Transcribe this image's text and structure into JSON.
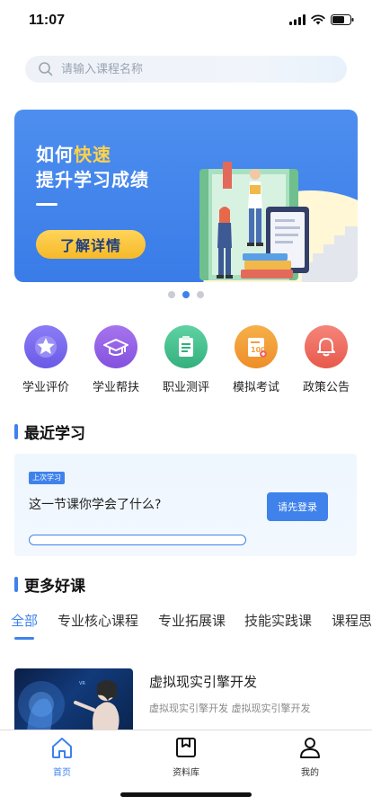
{
  "status_bar": {
    "time": "11:07"
  },
  "search": {
    "placeholder": "请输入课程名称"
  },
  "banner": {
    "title_prefix": "如何",
    "title_highlight": "快速",
    "title_line2": "提升学习成绩",
    "button_label": "了解详情",
    "page_count": 3,
    "active_index": 1
  },
  "quick_entries": [
    {
      "label": "学业评价",
      "icon": "star-icon",
      "color": "#7b6cf0"
    },
    {
      "label": "学业帮扶",
      "icon": "graduation-cap-icon",
      "color": "#9a63e8"
    },
    {
      "label": "职业测评",
      "icon": "clipboard-icon",
      "color": "#3fbf8e"
    },
    {
      "label": "模拟考试",
      "icon": "exam-paper-icon",
      "color": "#f2a03a"
    },
    {
      "label": "政策公告",
      "icon": "bell-icon",
      "color": "#ee6a5a"
    }
  ],
  "recent": {
    "section_title": "最近学习",
    "badge": "上次学习",
    "question": "这一节课你学会了什么?",
    "login_label": "请先登录",
    "progress": 0
  },
  "more_courses": {
    "section_title": "更多好课",
    "tabs": [
      "全部",
      "专业核心课程",
      "专业拓展课",
      "技能实践课",
      "课程思"
    ],
    "active_tab": 0
  },
  "course": {
    "title": "虚拟现实引擎开发",
    "subtitle": "虚拟现实引擎开发 虚拟现实引擎开发"
  },
  "bottom_nav": {
    "items": [
      {
        "label": "首页",
        "icon": "home-icon",
        "active": true
      },
      {
        "label": "资料库",
        "icon": "library-icon",
        "active": false
      },
      {
        "label": "我的",
        "icon": "user-icon",
        "active": false
      }
    ]
  },
  "colors": {
    "primary": "#3f82ec",
    "highlight": "#ffd24a"
  }
}
